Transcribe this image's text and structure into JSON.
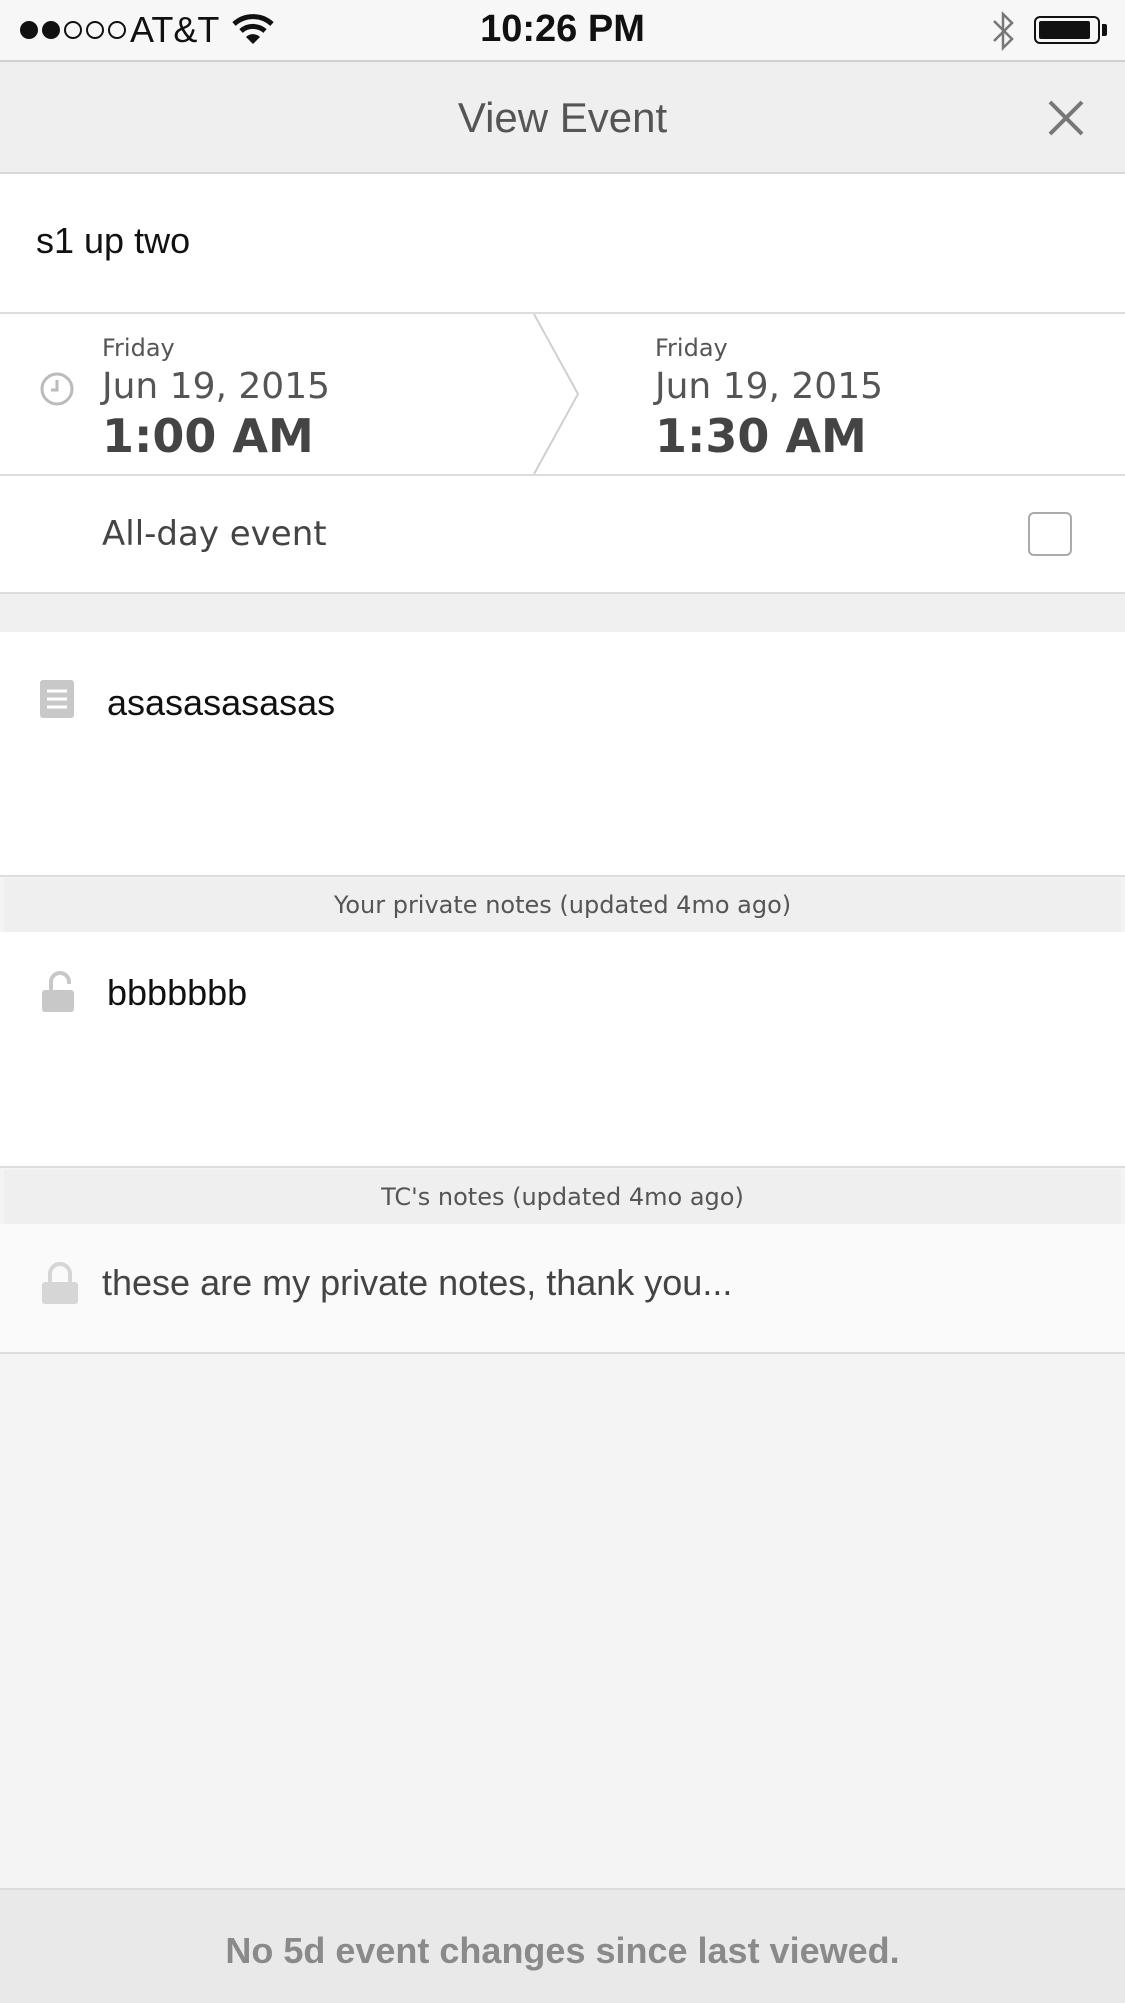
{
  "status_bar": {
    "carrier": "AT&T",
    "time": "10:26 PM",
    "signal_bars_filled": 2,
    "signal_bars_total": 5
  },
  "nav": {
    "title": "View Event",
    "close_icon": "close-icon"
  },
  "event": {
    "title": "s1 up two",
    "start": {
      "weekday": "Friday",
      "date": "Jun 19, 2015",
      "time": "1:00 AM"
    },
    "end": {
      "weekday": "Friday",
      "date": "Jun 19, 2015",
      "time": "1:30 AM"
    },
    "all_day_label": "All-day event",
    "all_day_checked": false,
    "description": "asasasasasas"
  },
  "private_notes": {
    "header": "Your private notes (updated 4mo ago)",
    "text": "bbbbbbb"
  },
  "tc_notes": {
    "header": "TC's notes (updated 4mo ago)",
    "text": "these are my private notes, thank you..."
  },
  "footer": {
    "message": "No 5d event changes since last viewed."
  },
  "colors": {
    "background": "#f4f4f4",
    "header": "#efefef",
    "text_muted": "#8a8a8a"
  }
}
